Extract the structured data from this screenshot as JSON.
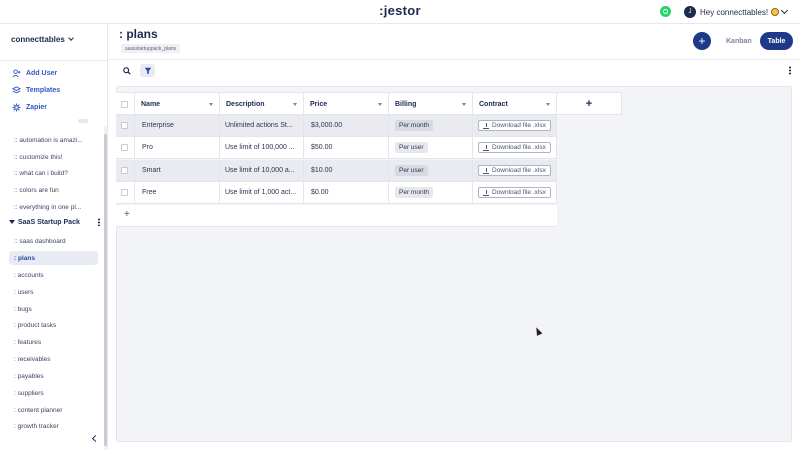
{
  "header": {
    "brand": ":jestor",
    "greeting": "Hey connecttables!",
    "avatar_initial": "J"
  },
  "sidebar": {
    "workspace": "connecttables",
    "quick_actions": [
      {
        "label": "Add User",
        "icon": "add-user-icon"
      },
      {
        "label": "Templates",
        "icon": "layers-icon"
      },
      {
        "label": "Zapier",
        "icon": "gear-icon"
      }
    ],
    "items_top": [
      ":: automation is amazi...",
      ":: customize this!",
      ":: what can i build?",
      ":: colors are fun",
      ":: everything in one pl..."
    ],
    "group": "SaaS Startup Pack",
    "group_items": [
      ":: saas dashboard",
      ": plans",
      ": accounts",
      ": users",
      ": bugs",
      ": product tasks",
      ": features",
      ": receivables",
      ": payables",
      ": suppliers",
      ": content planner",
      ": growth tracker"
    ]
  },
  "page": {
    "title": ": plans",
    "table_id": "saasstartuppack_plans",
    "views": [
      "Kanban",
      "Table"
    ],
    "active_view": "Table"
  },
  "table": {
    "columns": [
      "Name",
      "Description",
      "Price",
      "Billing",
      "Contract"
    ],
    "rows": [
      {
        "name": "Enterprise",
        "description": "Unlimited actions St...",
        "price": "$3,000.00",
        "billing": "Per month",
        "contract": "Download file .xlsx"
      },
      {
        "name": "Pro",
        "description": "Use limit of 100,000 ...",
        "price": "$50.00",
        "billing": "Per user",
        "contract": "Download file .xlsx"
      },
      {
        "name": "Smart",
        "description": "Use limit of 10,000 a...",
        "price": "$10.00",
        "billing": "Per user",
        "contract": "Download file .xlsx"
      },
      {
        "name": "Free",
        "description": "Use limit of 1,000 act...",
        "price": "$0.00",
        "billing": "Per month",
        "contract": "Download file .xlsx"
      }
    ]
  },
  "colors": {
    "primary": "#1d3a8a",
    "link": "#3257c7",
    "whatsapp": "#25d366"
  }
}
